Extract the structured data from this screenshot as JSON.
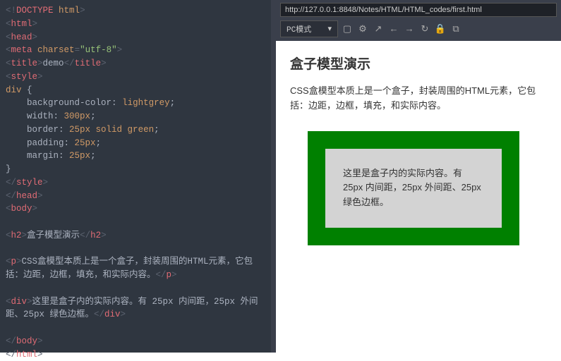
{
  "code": {
    "l1": "<!DOCTYPE html>",
    "l2_open": "<html>",
    "l3_open": "<head>",
    "l4_meta": "<meta charset=\"utf-8\">",
    "l5": {
      "open": "<title>",
      "text": "demo",
      "close": "</title>"
    },
    "l6_open": "<style>",
    "l7": "div {",
    "l8": {
      "prop": "background-color",
      "val": "lightgrey"
    },
    "l9": {
      "prop": "width",
      "val": "300px"
    },
    "l10": {
      "prop": "border",
      "val": "25px solid green"
    },
    "l11": {
      "prop": "padding",
      "val": "25px"
    },
    "l12": {
      "prop": "margin",
      "val": "25px"
    },
    "l13": "}",
    "l14_close": "</style>",
    "l15_close": "</head>",
    "l16_open": "<body>",
    "l18": {
      "open": "<h2>",
      "text": "盒子模型演示",
      "close": "</h2>"
    },
    "l20": {
      "open": "<p>",
      "text": "CSS盒模型本质上是一个盒子，封装周围的HTML元素，它包括：边距，边框，填充，和实际内容。",
      "close": "</p>"
    },
    "l22": {
      "open": "<div>",
      "text": "这里是盒子内的实际内容。有 25px 内间距，25px 外间距、25px 绿色边框。",
      "close": "</div>"
    },
    "l24_close": "</body>",
    "l25_close": "</html>"
  },
  "browser": {
    "url": "http://127.0.0.1:8848/Notes/HTML/HTML_codes/first.html",
    "mode": "PC模式"
  },
  "page": {
    "heading": "盒子模型演示",
    "paragraph": "CSS盒模型本质上是一个盒子，封装周围的HTML元素，它包括：边距，边框，填充，和实际内容。",
    "box": "这里是盒子内的实际内容。有 25px 内间距，25px 外间距、25px 绿色边框。"
  }
}
